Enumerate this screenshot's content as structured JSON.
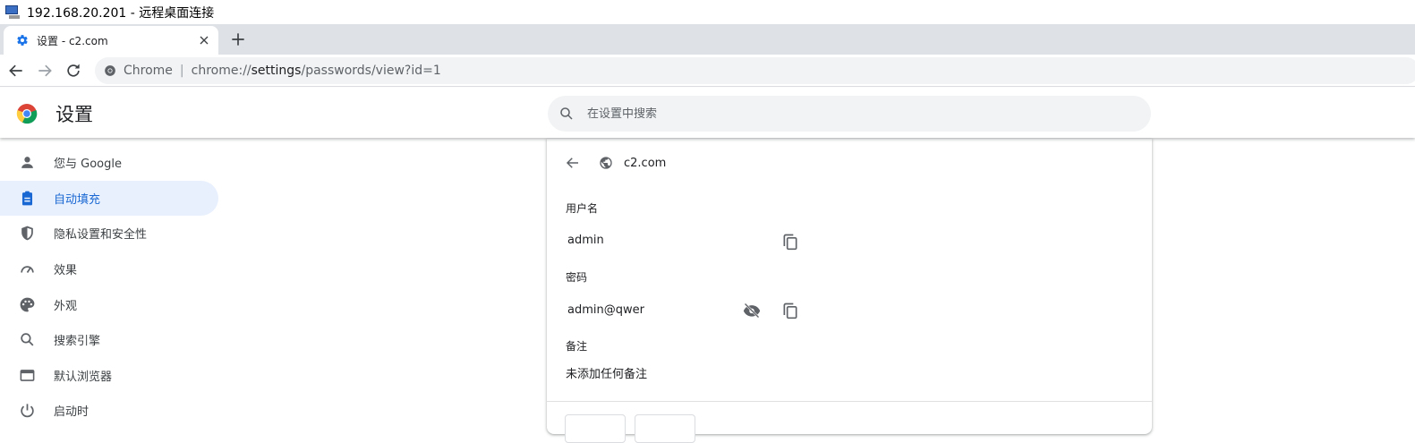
{
  "window": {
    "title": "192.168.20.201 - 远程桌面连接"
  },
  "tab": {
    "title": "设置 - c2.com"
  },
  "omnibox": {
    "chip": "Chrome",
    "url_prefix": "chrome://",
    "url_host": "settings",
    "url_path": "/passwords/view?id=1"
  },
  "header": {
    "title": "设置",
    "search_placeholder": "在设置中搜索"
  },
  "sidebar": {
    "items": [
      {
        "label": "您与 Google",
        "icon": "person-icon"
      },
      {
        "label": "自动填充",
        "icon": "clipboard-icon",
        "active": true
      },
      {
        "label": "隐私设置和安全性",
        "icon": "shield-icon"
      },
      {
        "label": "效果",
        "icon": "speedometer-icon"
      },
      {
        "label": "外观",
        "icon": "palette-icon"
      },
      {
        "label": "搜索引擎",
        "icon": "search-icon"
      },
      {
        "label": "默认浏览器",
        "icon": "browser-icon"
      },
      {
        "label": "启动时",
        "icon": "power-icon"
      }
    ]
  },
  "password": {
    "site": "c2.com",
    "username_label": "用户名",
    "username": "admin",
    "password_label": "密码",
    "password": "admin@qwer",
    "note_label": "备注",
    "note": "未添加任何备注"
  },
  "colors": {
    "accent": "#1967d2",
    "active_bg": "#e8f0fe",
    "tabstrip": "#dee1e6"
  }
}
